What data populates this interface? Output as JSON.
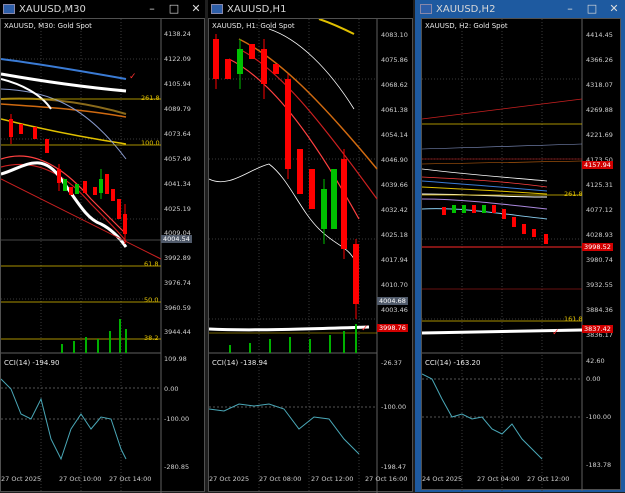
{
  "windows": [
    {
      "id": "m30",
      "title": "XAUUSD,M30",
      "chart_label": "XAUUSD, M30:  Gold Spot",
      "active": false,
      "price_labels": [
        "4138.24",
        "4122.09",
        "4105.94",
        "4089.79",
        "4073.64",
        "4057.49",
        "4041.34",
        "4025.19",
        "4009.04",
        "3992.89",
        "3976.74",
        "3960.59",
        "3944.44",
        "109.98"
      ],
      "fib_labels": [
        "261.8",
        "100.0",
        "61.8",
        "50.0",
        "38.2"
      ],
      "current_price": "4004.54",
      "indicator_label": "CCI(14) -194.90",
      "indicator_levels": [
        "0.00",
        "-100.00",
        "-280.85"
      ],
      "time_labels": [
        "27 Oct 2025",
        "27 Oct 10:00",
        "27 Oct 14:00"
      ]
    },
    {
      "id": "h1",
      "title": "XAUUSD,H1",
      "chart_label": "XAUUSD, H1:  Gold Spot",
      "active": false,
      "price_labels": [
        "4083.10",
        "4075.86",
        "4068.62",
        "4061.38",
        "4054.14",
        "4046.90",
        "4039.66",
        "4032.42",
        "4025.18",
        "4017.94",
        "4010.70",
        "4003.46"
      ],
      "current_price": "4004.68",
      "red_tag": "3998.76",
      "indicator_label": "CCI(14) -138.94",
      "indicator_levels": [
        "-26.37",
        "-100.00",
        "-198.47"
      ],
      "time_labels": [
        "27 Oct 2025",
        "27 Oct 08:00",
        "27 Oct 12:00",
        "27 Oct 16:00"
      ]
    },
    {
      "id": "h2",
      "title": "XAUUSD,H2",
      "chart_label": "XAUUSD, H2:  Gold Spot",
      "active": true,
      "price_labels": [
        "4414.45",
        "4366.26",
        "4318.07",
        "4269.88",
        "4221.69",
        "4173.50",
        "4125.31",
        "4077.12",
        "4028.93",
        "3980.74",
        "3932.55",
        "3884.36",
        "3836.17"
      ],
      "fib_labels": [
        "261.8",
        "161.8"
      ],
      "red_tags": [
        "4157.94",
        "3998.52",
        "3837.42"
      ],
      "indicator_label": "CCI(14) -163.20",
      "indicator_levels": [
        "42.60",
        "0.00",
        "-100.00",
        "-183.78"
      ],
      "time_labels": [
        "24 Oct 2025",
        "27 Oct 04:00",
        "27 Oct 12:00"
      ]
    }
  ],
  "window_buttons": {
    "minimize": "–",
    "maximize": "□",
    "close": "✕"
  },
  "colors": {
    "bull_candle": "#00c000",
    "bear_candle": "#ff0000",
    "fib_line": "#e0c000",
    "cci_line": "#4aa8b8",
    "active_border": "#1e5aa0",
    "price_tag_red": "#d00000"
  }
}
